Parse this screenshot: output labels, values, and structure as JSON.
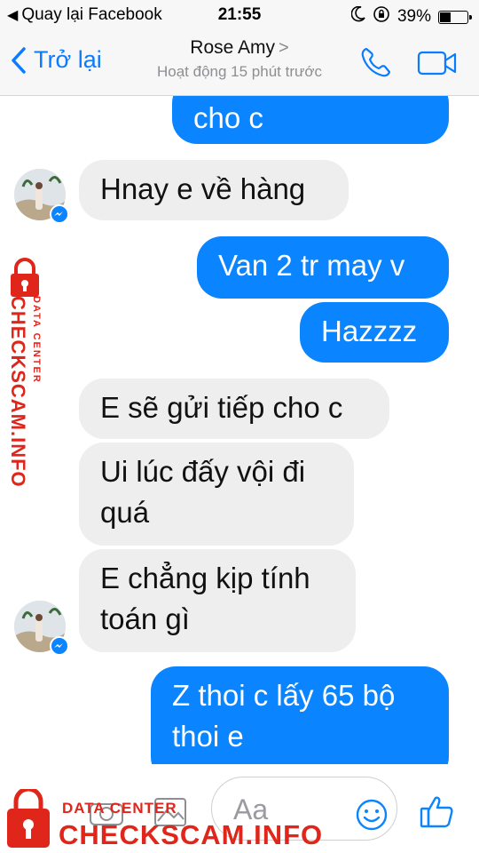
{
  "status_bar": {
    "back_app": "Quay lại Facebook",
    "time": "21:55",
    "battery_percent": "39%",
    "battery_level": 0.39,
    "icons": [
      "moon-icon",
      "orientation-lock-icon",
      "battery-icon"
    ]
  },
  "nav": {
    "back_label": "Trở lại",
    "contact_name": "Rose Amy",
    "chevron": ">",
    "status": "Hoạt động 15 phút trước",
    "icons": [
      "chevron-left-icon",
      "phone-icon",
      "video-camera-icon"
    ]
  },
  "messages": [
    {
      "from": "me",
      "text": "cho c"
    },
    {
      "from": "them",
      "text": "Hnay e về hàng"
    },
    {
      "from": "me",
      "text": "Van 2 tr may v"
    },
    {
      "from": "me",
      "text": "Hazzzz"
    },
    {
      "from": "them",
      "text": "E sẽ gửi tiếp cho c"
    },
    {
      "from": "them",
      "lines": [
        "Ui lúc đấy vội đi",
        "quá"
      ]
    },
    {
      "from": "them",
      "lines": [
        "E chẳng kịp tính",
        "toán gì"
      ]
    },
    {
      "from": "me",
      "lines": [
        "Z thoi c lấy 65 bộ",
        "thoi e"
      ]
    }
  ],
  "composer": {
    "placeholder": "Aa",
    "icons": [
      "camera-icon",
      "image-icon",
      "smiley-icon",
      "thumbs-up-icon"
    ]
  },
  "watermark": {
    "side_brand": "CHECKSCAM.INFO",
    "side_tag": "DATA CENTER",
    "bottom_tag": "DATA CENTER",
    "bottom_brand": "CHECKSCAM.INFO"
  },
  "colors": {
    "messenger_blue": "#0a84ff",
    "incoming_bubble": "#eeeeef",
    "watermark_red": "#e0251b",
    "link_blue": "#0a7cff"
  }
}
